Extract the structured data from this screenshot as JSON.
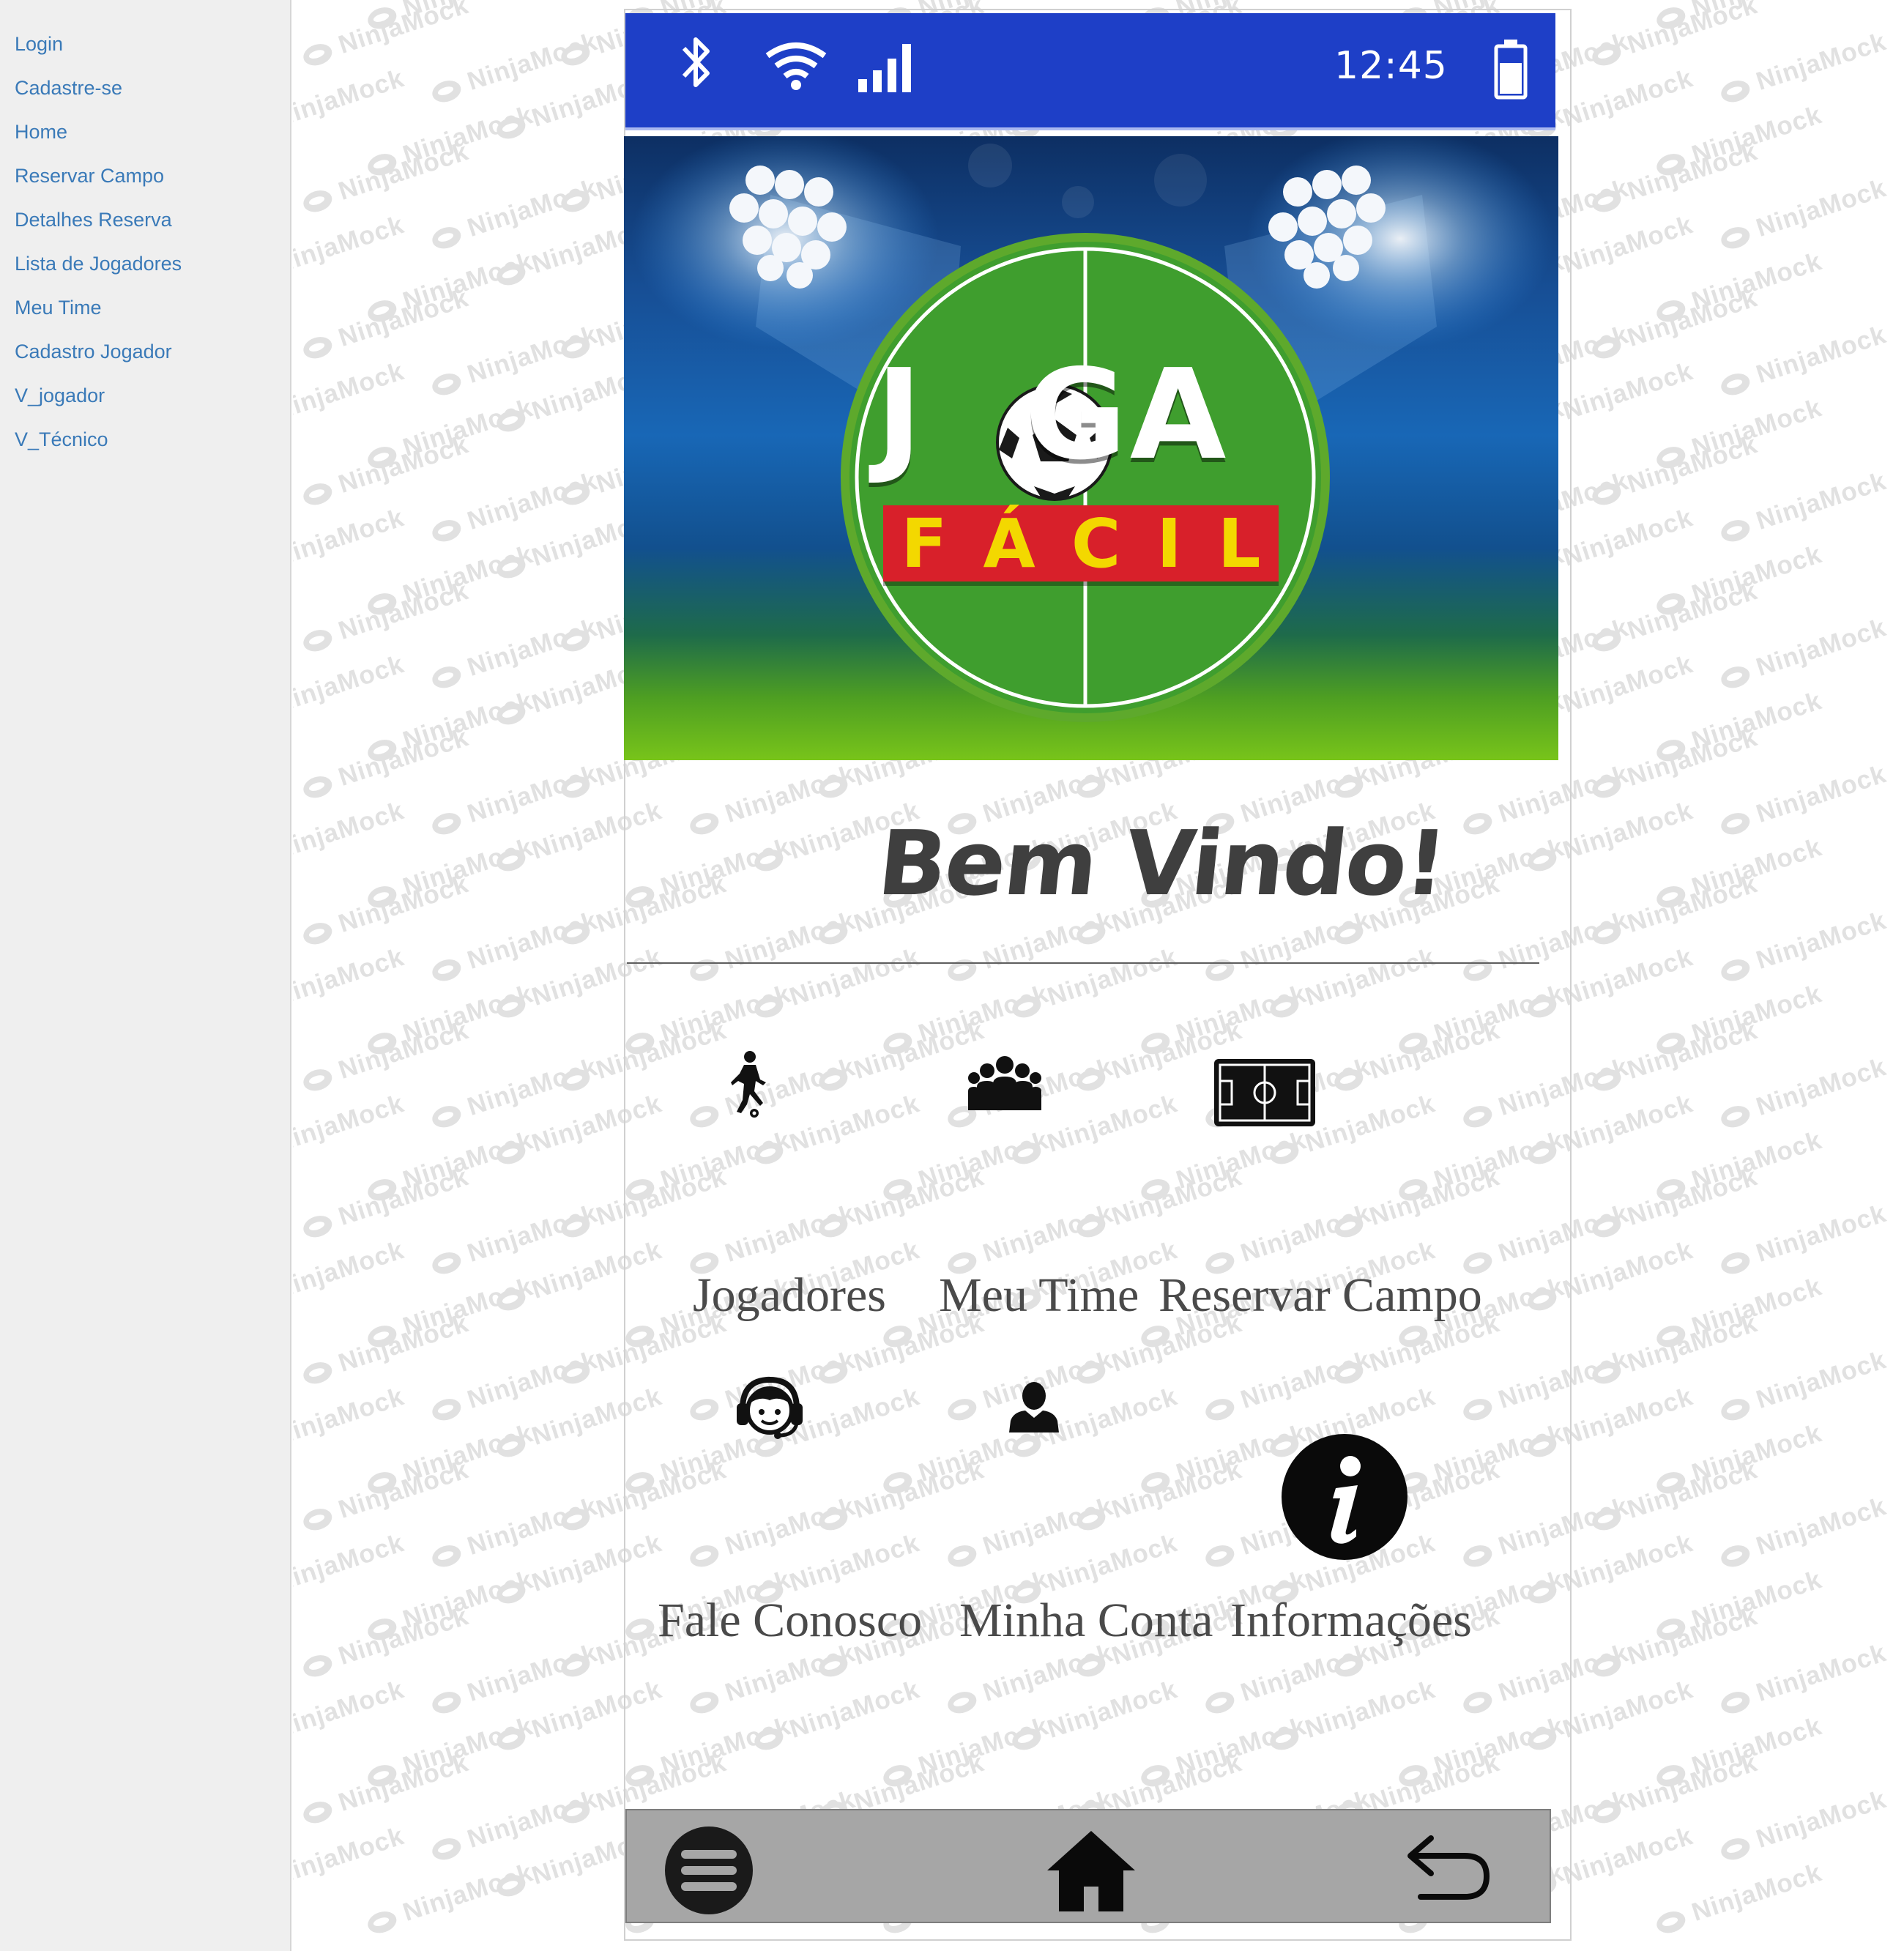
{
  "sidebar": {
    "items": [
      {
        "label": "Login"
      },
      {
        "label": "Cadastre-se"
      },
      {
        "label": "Home"
      },
      {
        "label": "Reservar Campo"
      },
      {
        "label": "Detalhes Reserva"
      },
      {
        "label": "Lista de Jogadores"
      },
      {
        "label": "Meu Time"
      },
      {
        "label": "Cadastro Jogador"
      },
      {
        "label": "V_jogador"
      },
      {
        "label": "V_Técnico"
      }
    ]
  },
  "watermark": {
    "text": "NinjaMock"
  },
  "status_bar": {
    "time": "12:45",
    "icons": [
      "bluetooth-icon",
      "wifi-icon",
      "signal-icon",
      "battery-icon"
    ],
    "color": "#1e3fc7"
  },
  "banner": {
    "logo_line1_left": "J",
    "logo_line1_right": "GA",
    "logo_line2": [
      "F",
      "Á",
      "C",
      "I",
      "L"
    ]
  },
  "welcome": {
    "title": "Bem Vindo!"
  },
  "menu": {
    "items": [
      {
        "label": "Jogadores",
        "icon": "soccer-player-icon"
      },
      {
        "label": "Meu Time",
        "icon": "team-group-icon"
      },
      {
        "label": "Reservar Campo",
        "icon": "soccer-field-icon"
      },
      {
        "label": "Fale Conosco",
        "icon": "support-headset-icon"
      },
      {
        "label": "Minha Conta",
        "icon": "user-account-icon"
      },
      {
        "label": "Informações",
        "icon": "info-icon"
      }
    ]
  },
  "navbar": {
    "icons": [
      "hamburger-menu-icon",
      "home-icon",
      "back-arrow-icon"
    ],
    "color": "#a6a6a6"
  }
}
